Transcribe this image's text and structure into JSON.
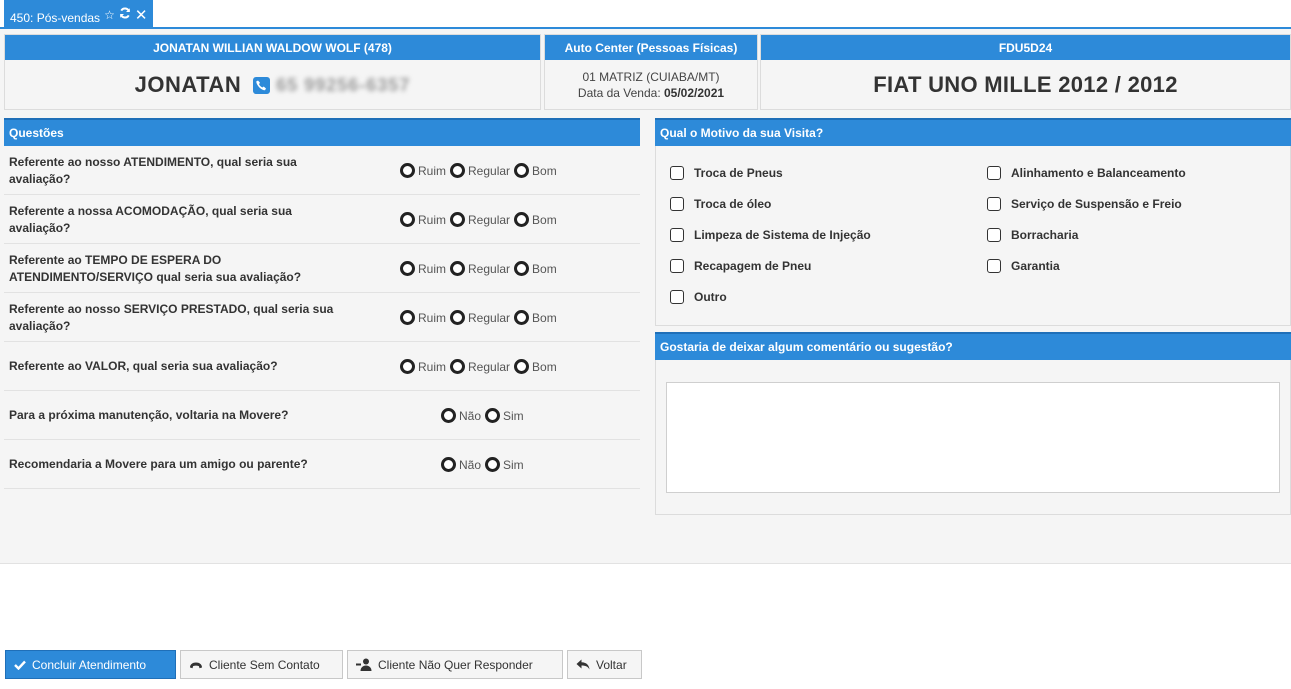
{
  "tab": {
    "label": "450: Pós-vendas",
    "icons": [
      "star-icon",
      "refresh-icon",
      "close-icon"
    ]
  },
  "client": {
    "header": "JONATAN WILLIAN WALDOW WOLF (478)",
    "first_name": "JONATAN",
    "phone": "65 99256-6357"
  },
  "store": {
    "header": "Auto Center (Pessoas Físicas)",
    "branch": "01 MATRIZ (CUIABA/MT)",
    "sale_date_label": "Data da Venda:",
    "sale_date": "05/02/2021"
  },
  "vehicle": {
    "plate": "FDU5D24",
    "model": "FIAT UNO MILLE 2012 / 2012"
  },
  "questions": {
    "title": "Questões",
    "items": [
      {
        "text": "Referente ao nosso ATENDIMENTO, qual seria sua avaliação?",
        "options": [
          "Ruim",
          "Regular",
          "Bom"
        ]
      },
      {
        "text": "Referente a nossa ACOMODAÇÃO, qual seria sua avaliação?",
        "options": [
          "Ruim",
          "Regular",
          "Bom"
        ]
      },
      {
        "text": "Referente ao TEMPO DE ESPERA DO ATENDIMENTO/SERVIÇO qual seria sua avaliação?",
        "options": [
          "Ruim",
          "Regular",
          "Bom"
        ]
      },
      {
        "text": "Referente ao nosso SERVIÇO PRESTADO, qual seria sua avaliação?",
        "options": [
          "Ruim",
          "Regular",
          "Bom"
        ]
      },
      {
        "text": "Referente ao VALOR, qual seria sua avaliação?",
        "options": [
          "Ruim",
          "Regular",
          "Bom"
        ]
      },
      {
        "text": "Para a próxima manutenção, voltaria na Movere?",
        "options": [
          "Não",
          "Sim"
        ]
      },
      {
        "text": "Recomendaria a Movere para um amigo ou parente?",
        "options": [
          "Não",
          "Sim"
        ]
      }
    ]
  },
  "motive": {
    "title": "Qual o Motivo da sua Visita?",
    "left": [
      "Troca de Pneus",
      "Troca de óleo",
      "Limpeza de Sistema de Injeção",
      "Recapagem de Pneu",
      "Outro"
    ],
    "right": [
      "Alinhamento e Balanceamento",
      "Serviço de Suspensão e Freio",
      "Borracharia",
      "Garantia"
    ]
  },
  "comment": {
    "title": "Gostaria de deixar algum comentário ou sugestão?",
    "value": ""
  },
  "buttons": {
    "concluir": "Concluir Atendimento",
    "sem_contato": "Cliente Sem Contato",
    "nao_quer": "Cliente Não Quer Responder",
    "voltar": "Voltar"
  },
  "colors": {
    "accent": "#2d8ad9",
    "panel": "#f5f5f5"
  }
}
